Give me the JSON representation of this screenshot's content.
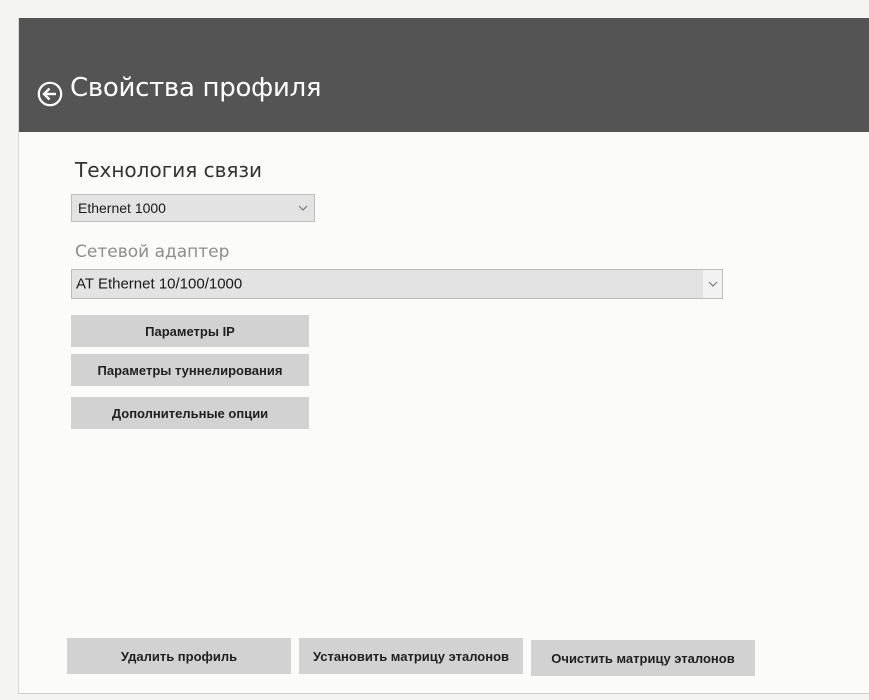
{
  "header": {
    "back_icon": "back-arrow-circle-icon",
    "title": "Свойства профиля",
    "background": "#545454"
  },
  "technology": {
    "label": "Технология связи",
    "selected": "Ethernet 1000"
  },
  "adapter": {
    "label": "Сетевой адаптер",
    "selected": "AT Ethernet 10/100/1000"
  },
  "buttons": {
    "ip_params": "Параметры IP",
    "tunnel_params": "Параметры туннелирования",
    "extra_options": "Дополнительные опции",
    "delete_profile": "Удалить профиль",
    "set_matrix": "Установить матрицу эталонов",
    "clear_matrix": "Очистить матрицу эталонов"
  },
  "colors": {
    "button_bg": "#d2d2d2",
    "select_bg": "#e3e3e3"
  }
}
